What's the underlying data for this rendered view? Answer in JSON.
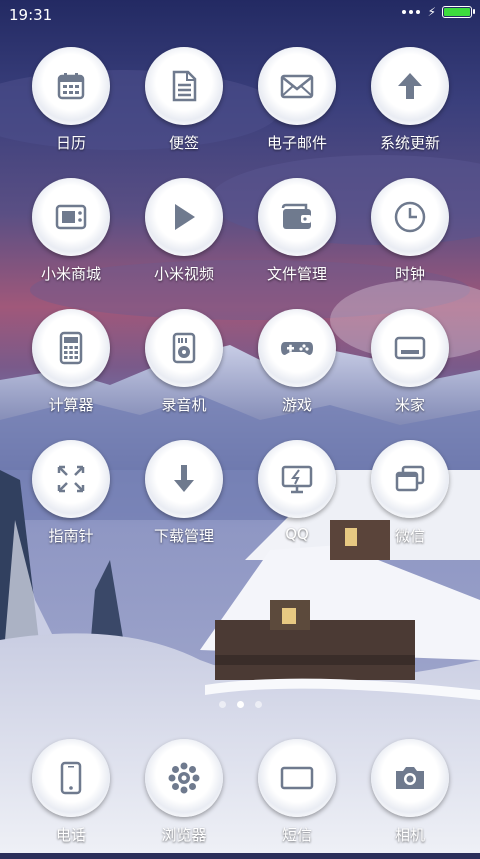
{
  "status_bar": {
    "time": "19:31",
    "battery_level": 1.0,
    "battery_color": "#3ddc3d",
    "icons": [
      "more-dots-icon",
      "charging-bolt-icon",
      "battery-icon"
    ]
  },
  "apps": [
    {
      "label": "日历",
      "icon": "calendar-icon"
    },
    {
      "label": "便签",
      "icon": "notes-icon"
    },
    {
      "label": "电子邮件",
      "icon": "mail-icon"
    },
    {
      "label": "系统更新",
      "icon": "update-arrow-icon"
    },
    {
      "label": "小米商城",
      "icon": "store-icon"
    },
    {
      "label": "小米视频",
      "icon": "video-play-icon"
    },
    {
      "label": "文件管理",
      "icon": "wallet-folder-icon"
    },
    {
      "label": "时钟",
      "icon": "clock-icon"
    },
    {
      "label": "计算器",
      "icon": "calculator-icon"
    },
    {
      "label": "录音机",
      "icon": "recorder-icon"
    },
    {
      "label": "游戏",
      "icon": "gamepad-icon"
    },
    {
      "label": "米家",
      "icon": "mihome-icon"
    },
    {
      "label": "指南针",
      "icon": "compass-arrows-icon"
    },
    {
      "label": "下载管理",
      "icon": "download-icon"
    },
    {
      "label": "QQ",
      "icon": "monitor-bolt-icon"
    },
    {
      "label": "微信",
      "icon": "windows-stack-icon"
    }
  ],
  "pager": {
    "count": 3,
    "active": 2
  },
  "dock": [
    {
      "label": "电话",
      "icon": "phone-icon"
    },
    {
      "label": "浏览器",
      "icon": "browser-gear-icon"
    },
    {
      "label": "短信",
      "icon": "message-screen-icon"
    },
    {
      "label": "相机",
      "icon": "camera-icon"
    }
  ],
  "colors": {
    "icon": "#6f7a8e",
    "label": "#ffffff",
    "sky_top": "#27306a",
    "sunset": "#b25a78",
    "snow": "#e4e7f1"
  }
}
